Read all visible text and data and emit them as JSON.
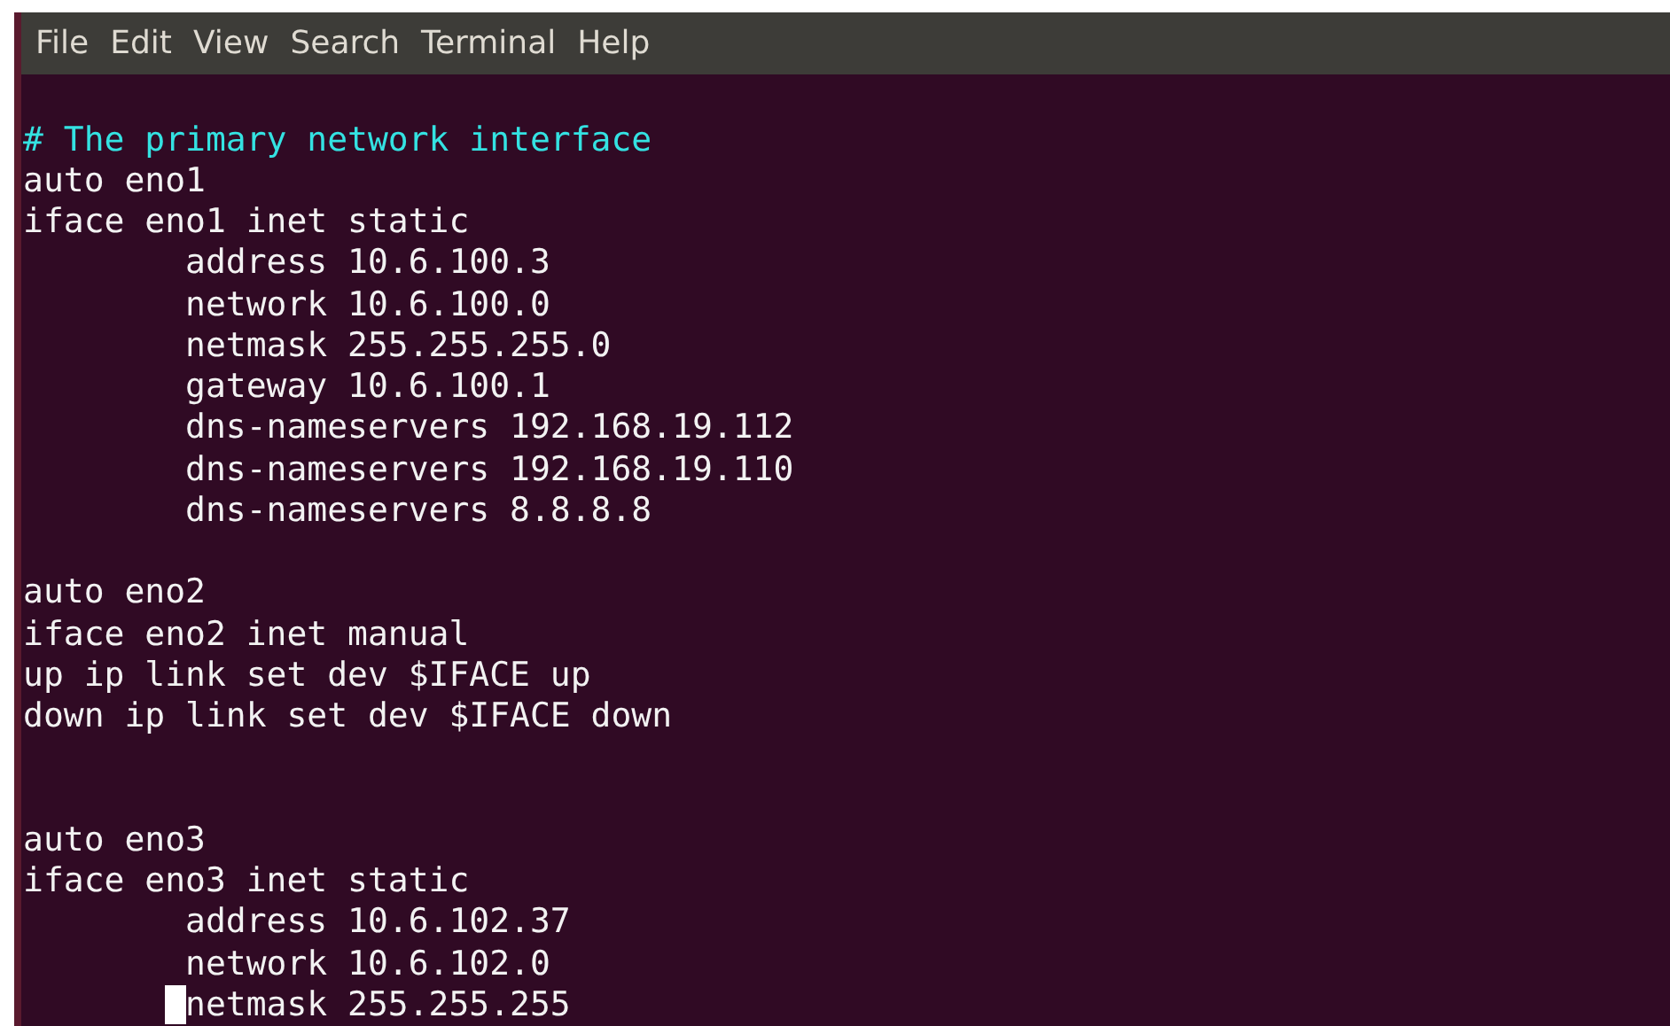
{
  "menu": [
    {
      "label": "File"
    },
    {
      "label": "Edit"
    },
    {
      "label": "View"
    },
    {
      "label": "Search"
    },
    {
      "label": "Terminal"
    },
    {
      "label": "Help"
    }
  ],
  "lines": [
    {
      "kind": "blank"
    },
    {
      "kind": "comment",
      "text": "# The primary network interface"
    },
    {
      "kind": "code",
      "text": "auto eno1"
    },
    {
      "kind": "code",
      "text": "iface eno1 inet static"
    },
    {
      "kind": "code",
      "indented": true,
      "text": "address 10.6.100.3"
    },
    {
      "kind": "code",
      "indented": true,
      "text": "network 10.6.100.0"
    },
    {
      "kind": "code",
      "indented": true,
      "text": "netmask 255.255.255.0"
    },
    {
      "kind": "code",
      "indented": true,
      "text": "gateway 10.6.100.1"
    },
    {
      "kind": "code",
      "indented": true,
      "text": "dns-nameservers 192.168.19.112"
    },
    {
      "kind": "code",
      "indented": true,
      "text": "dns-nameservers 192.168.19.110"
    },
    {
      "kind": "code",
      "indented": true,
      "text": "dns-nameservers 8.8.8.8"
    },
    {
      "kind": "blank"
    },
    {
      "kind": "code",
      "text": "auto eno2"
    },
    {
      "kind": "code",
      "text": "iface eno2 inet manual"
    },
    {
      "kind": "code",
      "text": "up ip link set dev $IFACE up"
    },
    {
      "kind": "code",
      "text": "down ip link set dev $IFACE down"
    },
    {
      "kind": "blank"
    },
    {
      "kind": "blank"
    },
    {
      "kind": "code",
      "text": "auto eno3"
    },
    {
      "kind": "code",
      "text": "iface eno3 inet static"
    },
    {
      "kind": "code",
      "indented": true,
      "text": "address 10.6.102.37"
    },
    {
      "kind": "code",
      "indented": true,
      "text": "network 10.6.102.0"
    },
    {
      "kind": "code",
      "indented": true,
      "cursor": true,
      "text": "netmask 255.255.255"
    }
  ]
}
